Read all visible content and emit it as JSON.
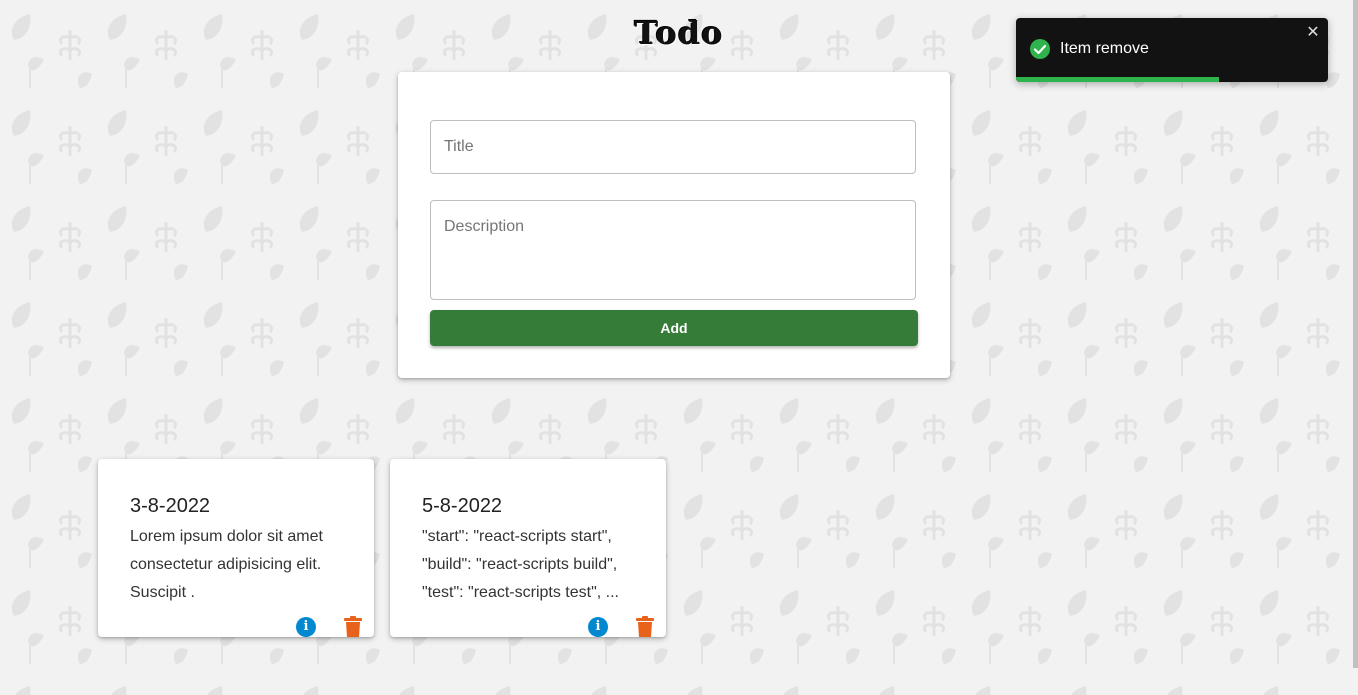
{
  "header": {
    "title": "Todo"
  },
  "form": {
    "title_placeholder": "Title",
    "description_placeholder": "Description",
    "add_label": "Add"
  },
  "todos": [
    {
      "date": "3-8-2022",
      "description": "Lorem ipsum dolor sit amet consectetur adipisicing elit. Suscipit ."
    },
    {
      "date": "5-8-2022",
      "description": "\"start\": \"react-scripts start\", \"build\": \"react-scripts build\", \"test\": \"react-scripts test\", ..."
    }
  ],
  "toast": {
    "message": "Item remove",
    "close_symbol": "✕",
    "progress": 0.65,
    "type": "success"
  },
  "colors": {
    "add_button": "#367c39",
    "info_icon": "#0288d1",
    "trash_icon": "#e8621c",
    "toast_bg": "#121212",
    "toast_progress": "#2fb34d"
  },
  "icons": {
    "info": "info-icon",
    "trash": "trash-icon",
    "check": "check-circle-icon",
    "close": "close-icon"
  }
}
